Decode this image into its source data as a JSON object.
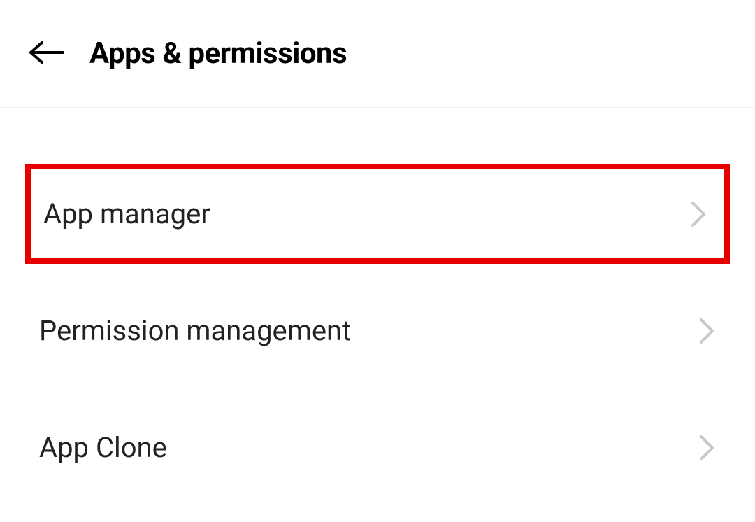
{
  "header": {
    "title": "Apps & permissions"
  },
  "items": [
    {
      "label": "App manager",
      "highlighted": true
    },
    {
      "label": "Permission management",
      "highlighted": false
    },
    {
      "label": "App Clone",
      "highlighted": false
    }
  ]
}
